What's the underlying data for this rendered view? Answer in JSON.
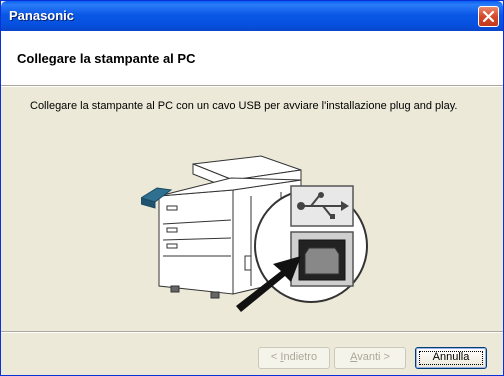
{
  "window": {
    "title": "Panasonic"
  },
  "header": {
    "title": "Collegare la stampante al PC"
  },
  "body": {
    "instructions": "Collegare la stampante al PC con un cavo USB per avviare l'installazione plug and play."
  },
  "buttons": {
    "back_prefix": "< ",
    "back_mnemonic": "I",
    "back_rest": "ndietro",
    "next_mnemonic": "A",
    "next_rest": "vanti >",
    "cancel": "Annulla"
  },
  "icons": {
    "close": "close-icon",
    "usb": "usb-icon",
    "usb_port": "usb-port-icon",
    "arrow": "arrow-icon",
    "printer": "printer-icon"
  },
  "colors": {
    "titlebar": "#0a5ff1",
    "close_button": "#d5492b",
    "dialog_bg": "#ece9d8",
    "header_bg": "#ffffff"
  }
}
